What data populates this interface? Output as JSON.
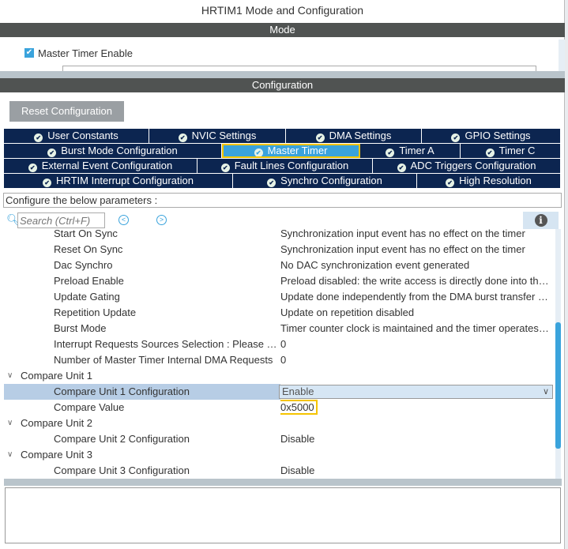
{
  "window": {
    "title": "HRTIM1 Mode and Configuration"
  },
  "mode": {
    "header": "Mode",
    "master_timer_enable": {
      "label": "Master Timer Enable",
      "checked": true
    }
  },
  "config": {
    "header": "Configuration",
    "reset_label": "Reset Configuration",
    "tabs": [
      [
        {
          "label": "User Constants"
        },
        {
          "label": "NVIC Settings"
        },
        {
          "label": "DMA Settings"
        },
        {
          "label": "GPIO Settings"
        }
      ],
      [
        {
          "label": "Burst Mode Configuration"
        },
        {
          "label": "Master Timer",
          "selected": true
        },
        {
          "label": "Timer A"
        },
        {
          "label": "Timer C"
        }
      ],
      [
        {
          "label": "External Event Configuration"
        },
        {
          "label": "Fault Lines Configuration"
        },
        {
          "label": "ADC Triggers Configuration"
        }
      ],
      [
        {
          "label": "HRTIM Interrupt Configuration"
        },
        {
          "label": "Synchro Configuration"
        },
        {
          "label": "High Resolution"
        }
      ]
    ],
    "hint": "Configure the below parameters :",
    "search_placeholder": "Search (Ctrl+F)",
    "params": [
      {
        "label": "Start On Sync",
        "value": "Synchronization input event has no effect on the timer"
      },
      {
        "label": "Reset On Sync",
        "value": "Synchronization input event has no effect on the timer"
      },
      {
        "label": "Dac Synchro",
        "value": "No DAC synchronization event generated"
      },
      {
        "label": "Preload Enable",
        "value": "Preload disabled: the write access is directly done into the active register"
      },
      {
        "label": "Update Gating",
        "value": "Update done independently from the DMA burst transfer completion"
      },
      {
        "label": "Repetition Update",
        "value": "Update on repetition disabled"
      },
      {
        "label": "Burst Mode",
        "value": "Timer counter clock is maintained and the timer operates normally"
      },
      {
        "label": "Interrupt Requests Sources Selection : Please select",
        "value": "0"
      },
      {
        "label": "Number of Master Timer Internal DMA Requests",
        "value": "0"
      },
      {
        "group": "Compare Unit 1"
      },
      {
        "label": "Compare Unit 1 Configuration",
        "value": "Enable",
        "dropdown": true
      },
      {
        "label": "Compare Value",
        "value": "0x5000",
        "highlight": true
      },
      {
        "group": "Compare Unit 2"
      },
      {
        "label": "Compare Unit 2 Configuration",
        "value": "Disable"
      },
      {
        "group": "Compare Unit 3"
      },
      {
        "label": "Compare Unit 3 Configuration",
        "value": "Disable"
      }
    ]
  },
  "colors": {
    "tab_bg": "#0c2550",
    "tab_selected": "#3aa3dc",
    "highlight": "#f5c400",
    "header_bg": "#505352"
  }
}
